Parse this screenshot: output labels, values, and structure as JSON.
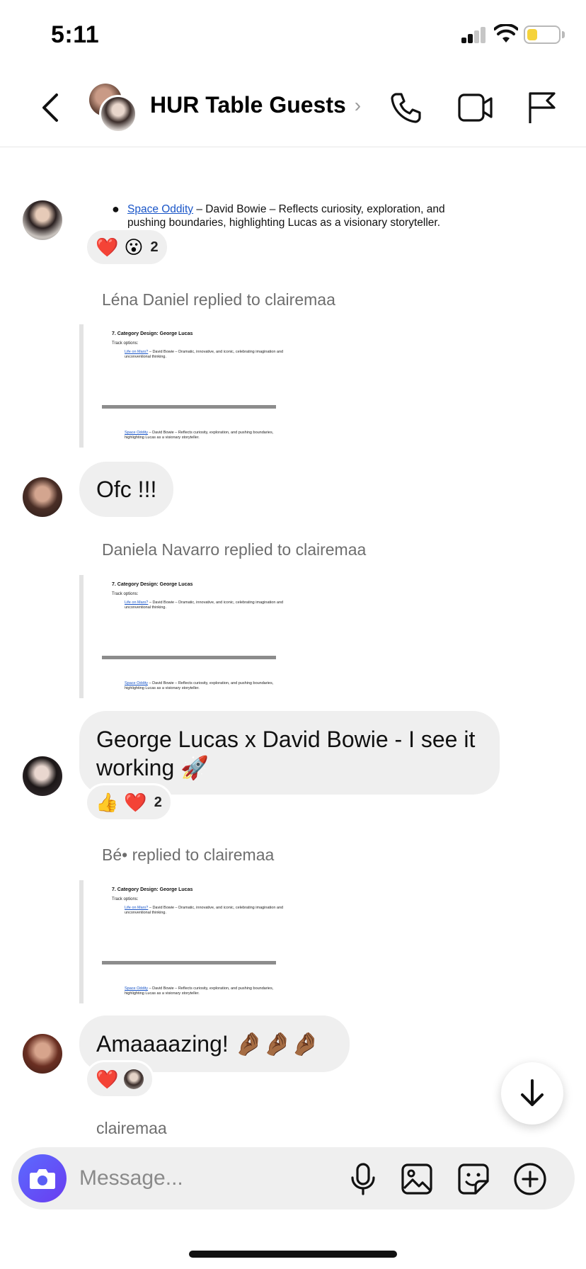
{
  "status_bar": {
    "time": "5:11",
    "battery_color": "#f5d33b"
  },
  "header": {
    "title": "HUR Table Guests",
    "chevron": "›"
  },
  "messages": [
    {
      "doc": {
        "link": "Space Oddity",
        "text": " – David Bowie – Reflects curiosity, exploration, and pushing boundaries, highlighting Lucas as a visionary storyteller."
      },
      "reactions": {
        "emojis": [
          "❤️",
          "😮"
        ],
        "count": "2"
      }
    },
    {
      "reply_label": "Léna Daniel replied to clairemaa",
      "text": "Ofc !!!"
    },
    {
      "reply_label": "Daniela Navarro replied to clairemaa",
      "text": "George Lucas x David Bowie - I see it working 🚀",
      "reactions": {
        "emojis": [
          "👍",
          "❤️"
        ],
        "count": "2"
      }
    },
    {
      "reply_label": "Bé• replied to clairemaa",
      "text": "Amaaaazing! 🤌🏾🤌🏾🤌🏾",
      "reactions": {
        "emojis": [
          "❤️"
        ]
      }
    }
  ],
  "quoted_doc": {
    "title": "7. Category Design: George Lucas",
    "subtitle": "Track options:",
    "item1_link": "Life on Mars?",
    "item1_text": " – David Bowie – Dramatic, innovative, and iconic, celebrating imagination and unconventional thinking.",
    "item2_link": "Space Oddity",
    "item2_text": " – David Bowie – Reflects curiosity, exploration, and pushing boundaries, highlighting Lucas as a visionary storyteller."
  },
  "sender_name": "clairemaa",
  "composer": {
    "placeholder": "Message..."
  },
  "colors": {
    "accent": "#5b5ff5",
    "bubble": "#efefef"
  }
}
